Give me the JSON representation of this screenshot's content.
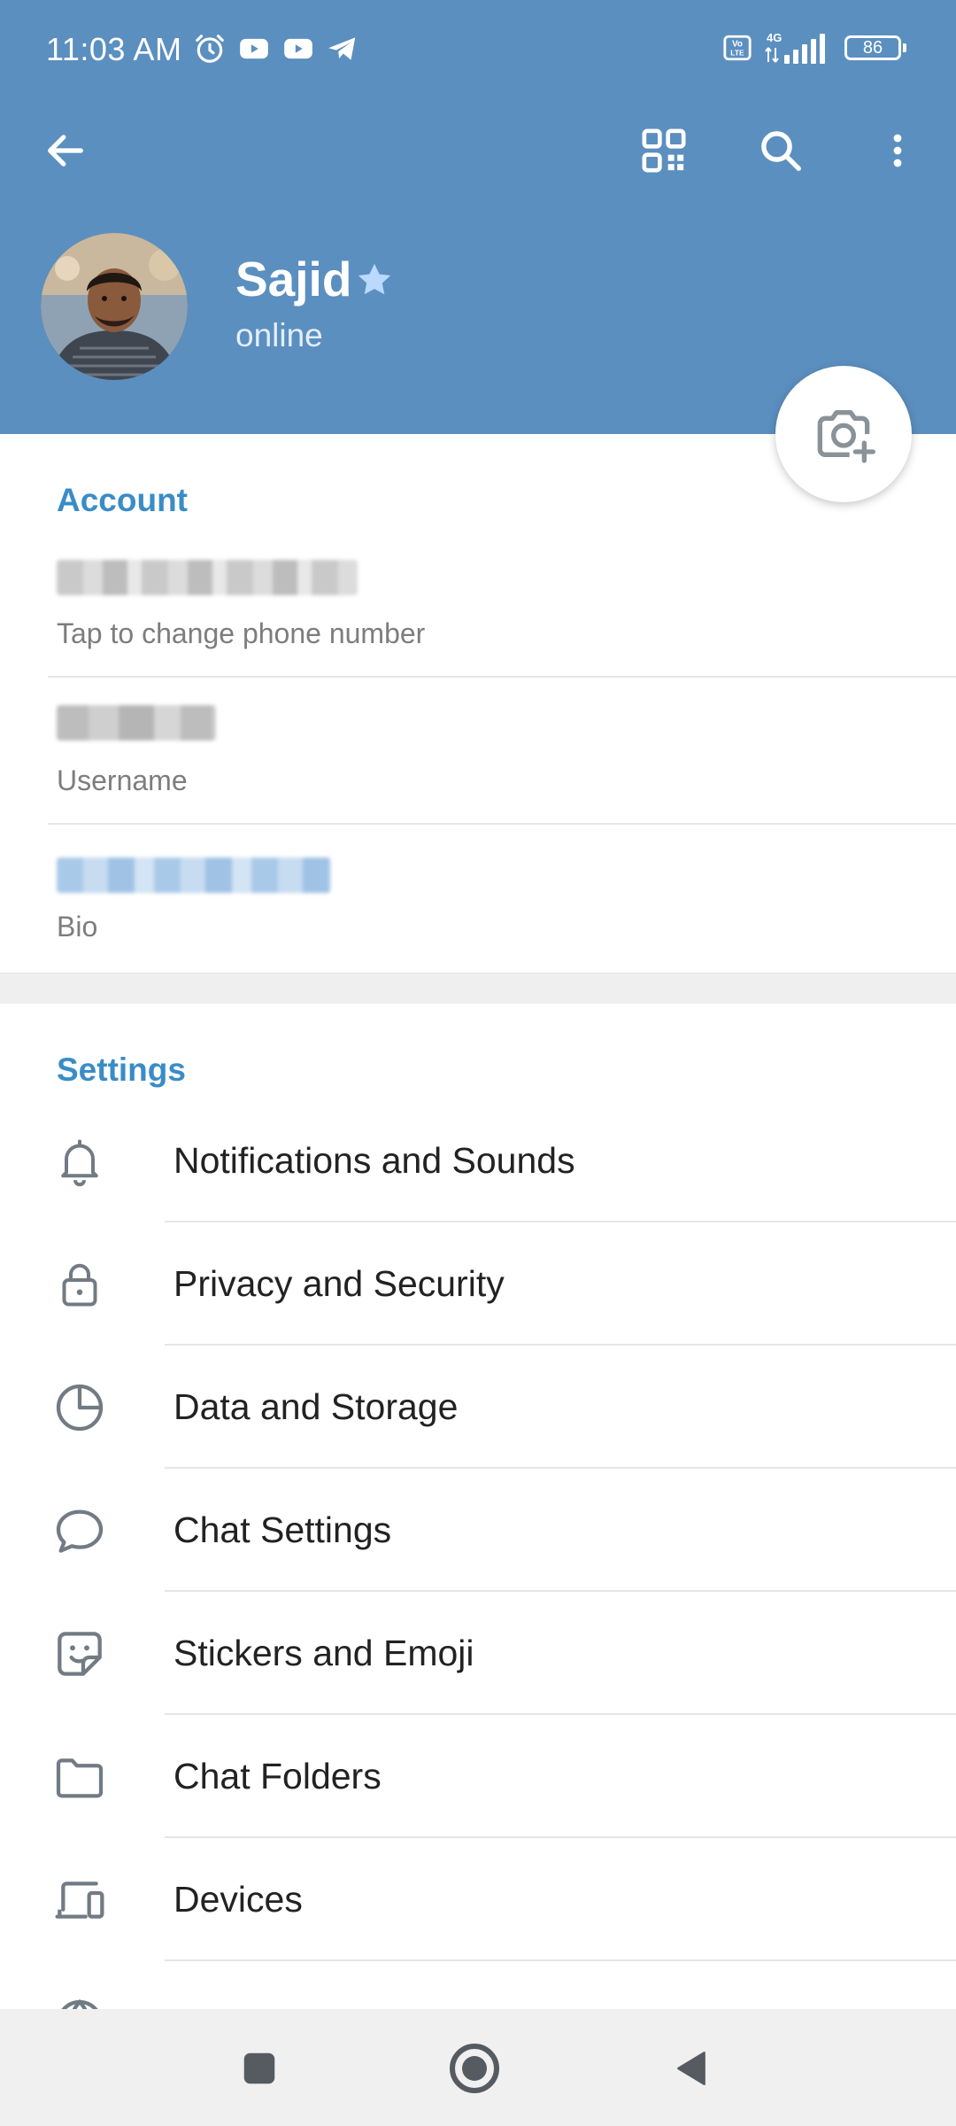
{
  "status_bar": {
    "time": "11:03 AM",
    "left_icons": [
      "alarm-icon",
      "youtube-icon",
      "youtube-icon",
      "telegram-icon"
    ],
    "right_icons": [
      "volte-icon",
      "4g-signal-icon"
    ],
    "network_label": "4G",
    "battery": "86"
  },
  "toolbar": {
    "back_icon": "arrow-left-icon",
    "actions": [
      "qr-code-icon",
      "search-icon",
      "more-vertical-icon"
    ]
  },
  "profile": {
    "name": "Sajid",
    "status": "online",
    "badge_icon": "star-icon",
    "camera_icon": "camera-add-icon"
  },
  "account": {
    "title": "Account",
    "phone_caption": "Tap to change phone number",
    "username_caption": "Username",
    "bio_caption": "Bio"
  },
  "settings": {
    "title": "Settings",
    "items": [
      {
        "label": "Notifications and Sounds",
        "icon": "bell-icon"
      },
      {
        "label": "Privacy and Security",
        "icon": "lock-icon"
      },
      {
        "label": "Data and Storage",
        "icon": "pie-chart-icon"
      },
      {
        "label": "Chat Settings",
        "icon": "chat-bubble-icon"
      },
      {
        "label": "Stickers and Emoji",
        "icon": "sticker-icon"
      },
      {
        "label": "Chat Folders",
        "icon": "folder-icon"
      },
      {
        "label": "Devices",
        "icon": "devices-icon"
      },
      {
        "label": "",
        "icon": "globe-icon"
      }
    ]
  },
  "navbar": {
    "buttons": [
      "recents-square-icon",
      "home-circle-icon",
      "back-triangle-icon"
    ]
  },
  "colors": {
    "header": "#5b8fbf",
    "accent": "#3a8cc7",
    "icon": "#727b84",
    "text": "#222222",
    "caption": "#7d7d7d"
  }
}
